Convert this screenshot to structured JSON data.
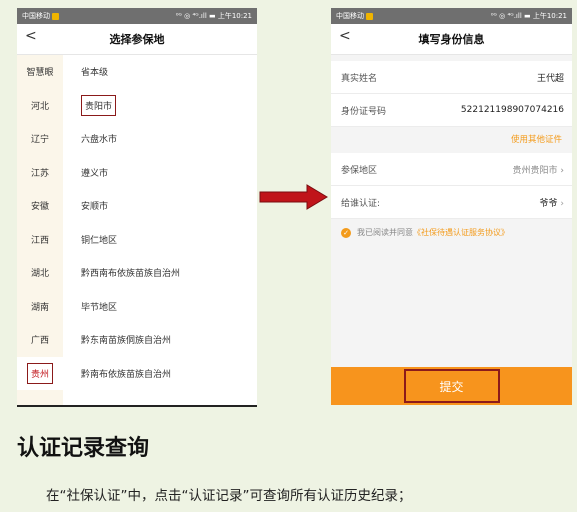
{
  "left_phone": {
    "status_left": "中国移动",
    "status_right": "⁰ᴳ ◎ ⁴ᴳ.ıll ▬ 上午10:21",
    "back": "<",
    "title": "选择参保地",
    "provinces": [
      "智慧眼",
      "河北",
      "辽宁",
      "江苏",
      "安徽",
      "江西",
      "湖北",
      "湖南",
      "广西",
      "贵州"
    ],
    "cities": [
      "省本级",
      "贵阳市",
      "六盘水市",
      "遵义市",
      "安顺市",
      "铜仁地区",
      "黔西南布依族苗族自治州",
      "毕节地区",
      "黔东南苗族侗族自治州",
      "黔南布依族苗族自治州"
    ]
  },
  "right_phone": {
    "status_left": "中国移动",
    "status_right": "⁰ᴳ ◎ ⁴ᴳ.ıll ▬ 上午10:21",
    "back": "<",
    "title": "填写身份信息",
    "name_label": "真实姓名",
    "name_value": "王代超",
    "id_label": "身份证号码",
    "id_value": "522121198907074216",
    "other_id": "使用其他证件",
    "region_label": "参保地区",
    "region_value": "贵州贵阳市",
    "certify_for_label": "给谁认证:",
    "certify_for_value": "爷爷",
    "agree_prefix": "我已阅读并同意",
    "agree_link": "《社保待遇认证服务协议》",
    "submit": "提交"
  },
  "arrow_color": "#c0141a",
  "accent_color": "#f7941d",
  "heading": "认证记录查询",
  "body_text": "在“社保认证”中，点击“认证记录”可查询所有认证历史纪录；"
}
